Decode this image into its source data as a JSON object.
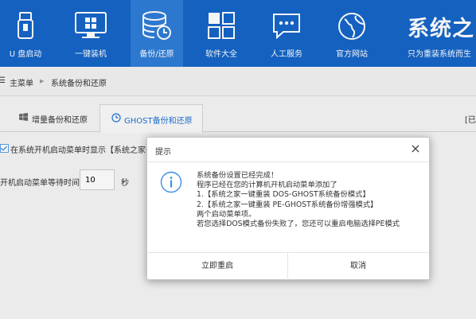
{
  "nav": {
    "items": [
      {
        "label": "U 盘启动",
        "icon": "usb-drive-icon"
      },
      {
        "label": "一键装机",
        "icon": "monitor-icon"
      },
      {
        "label": "备份/还原",
        "icon": "database-backup-icon"
      },
      {
        "label": "软件大全",
        "icon": "app-grid-icon"
      },
      {
        "label": "人工服务",
        "icon": "chat-bubble-icon"
      },
      {
        "label": "官方网站",
        "icon": "globe-icon"
      }
    ],
    "active_index": 2
  },
  "brand": {
    "title": "系统之",
    "subtitle": "只为重装系统而生"
  },
  "breadcrumb": {
    "home": "主菜单",
    "separator": "▶",
    "current": "系统备份和还原"
  },
  "tabs": [
    {
      "label": "增量备份和还原"
    },
    {
      "label": "GHOST备份和还原"
    }
  ],
  "tabs_right_text": "[已",
  "options": {
    "boot_menu_label": "在系统开机启动菜单时显示【系统之家一",
    "wait_label": "开机启动菜单等待时间",
    "wait_value": "10",
    "wait_unit": "秒"
  },
  "dialog": {
    "title": "提示",
    "close": "×",
    "lines": [
      "系统备份设置已经完成！",
      "程序已经在您的计算机开机启动菜单添加了",
      "1.【系统之家一键重装 DOS-GHOST系统备份模式】",
      "2.【系统之家一键重装 PE-GHOST系统备份增强模式】",
      "两个启动菜单项。",
      "若您选择DOS模式备份失败了，您还可以重启电脑选择PE模式"
    ],
    "restart_button": "立即重启",
    "cancel_button": "取消"
  },
  "colors": {
    "topbar": "#1565c8",
    "active_nav": "#2f7dd8",
    "accent": "#1f73d6"
  }
}
